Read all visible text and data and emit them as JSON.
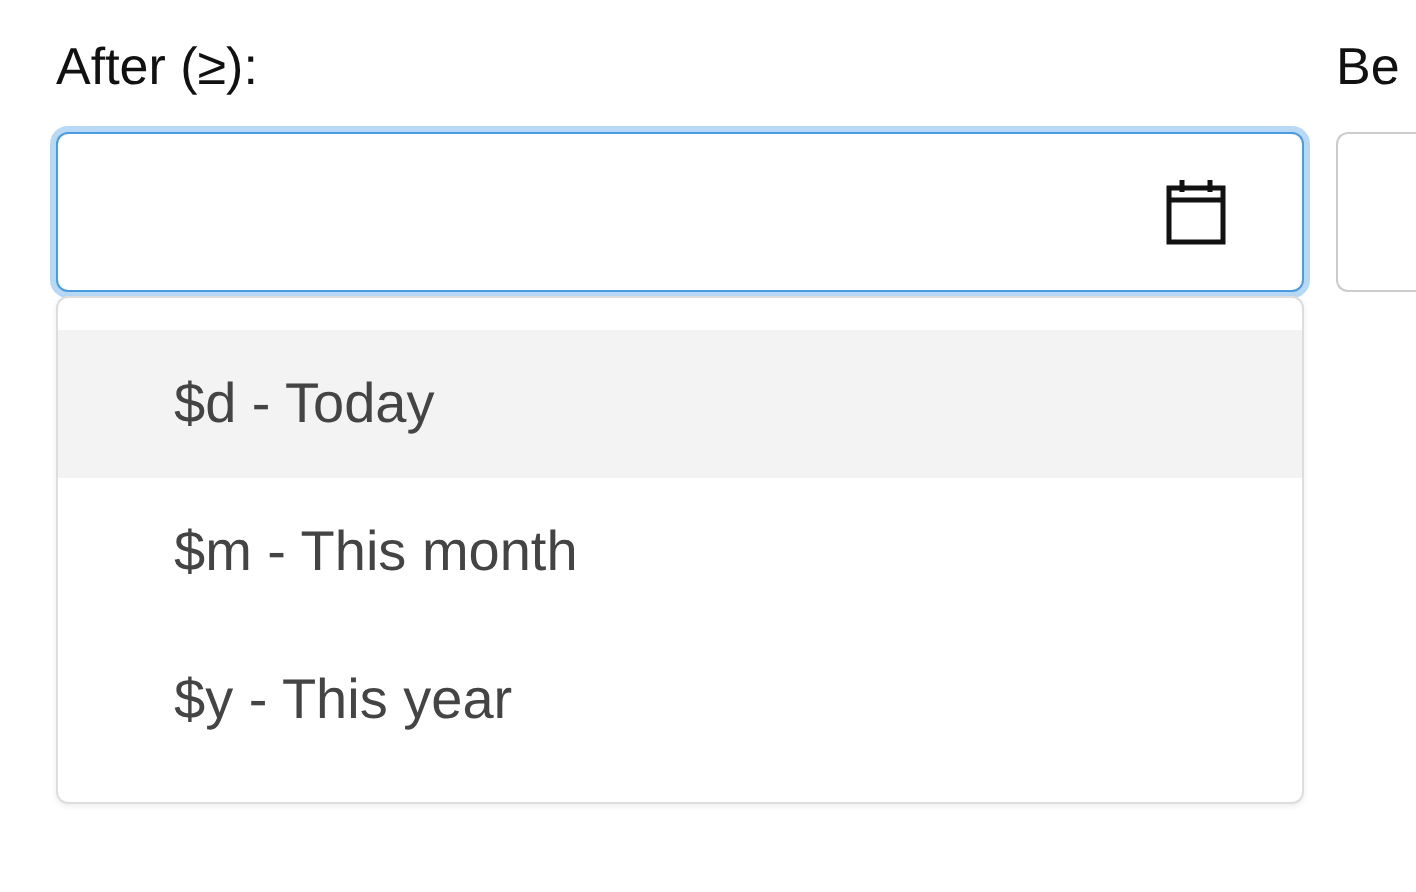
{
  "fields": [
    {
      "label": "After (≥):",
      "focused": true,
      "has_calendar": true
    },
    {
      "label": "Be",
      "focused": false,
      "has_calendar": false
    }
  ],
  "dropdown": {
    "options": [
      {
        "label": "$d - Today",
        "selected": true
      },
      {
        "label": "$m - This month",
        "selected": false
      },
      {
        "label": "$y - This year",
        "selected": false
      }
    ]
  }
}
